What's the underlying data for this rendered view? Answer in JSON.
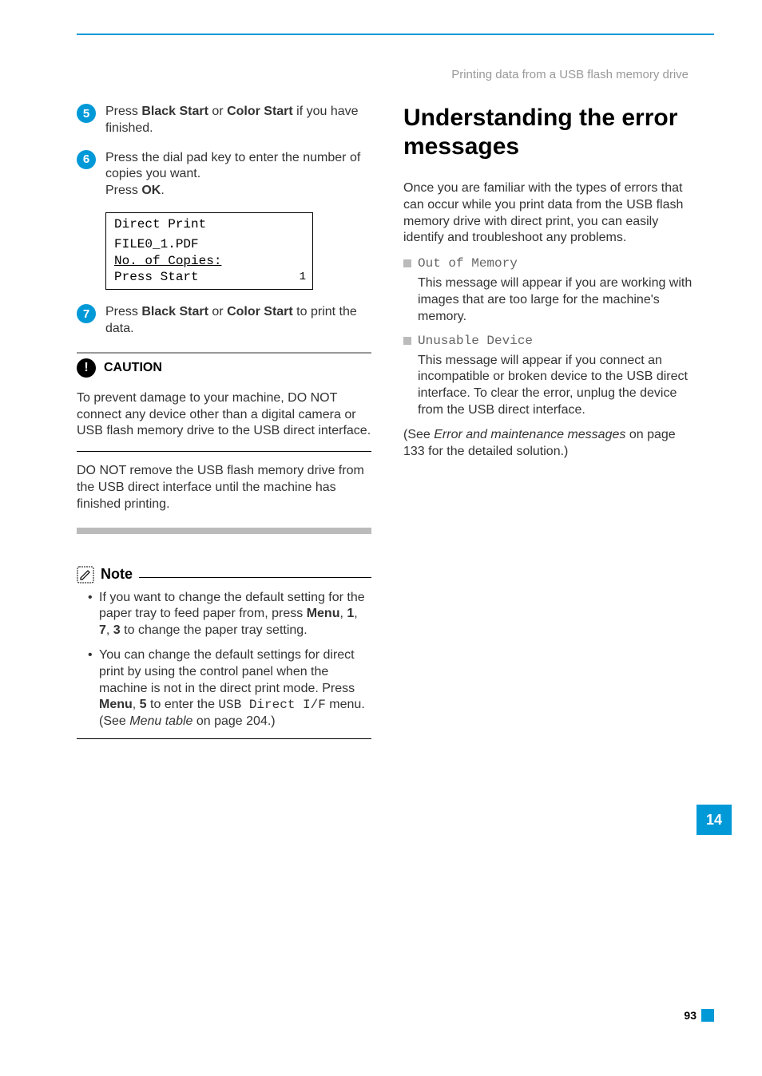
{
  "header": "Printing data from a USB flash memory drive",
  "steps": {
    "s5": {
      "num": "5",
      "text_pre": "Press ",
      "b1": "Black Start",
      "mid1": " or ",
      "b2": "Color Start",
      "text_post": " if you have finished."
    },
    "s6": {
      "num": "6",
      "line1": "Press the dial pad key to enter the number of copies you want.",
      "press": "Press ",
      "ok": "OK",
      "dot": "."
    },
    "lcd": {
      "l1": "Direct Print",
      "l2": " FILE0_1.PDF",
      "l3": "   No. of Copies:",
      "l4": "Press Start",
      "arrow": "1"
    },
    "s7": {
      "num": "7",
      "pre": "Press ",
      "b1": "Black Start",
      "mid": " or ",
      "b2": "Color Start",
      "post": " to print the data."
    }
  },
  "caution": {
    "label": "CAUTION",
    "p1": "To prevent damage to your machine, DO NOT connect any device other than a digital camera or USB flash memory drive to the USB direct interface.",
    "p2": "DO NOT remove the USB flash memory drive from the USB direct interface until the machine has finished printing."
  },
  "note": {
    "label": "Note",
    "n1_pre": "If you want to change the default setting for the paper tray to feed paper from, press ",
    "n1_b1": "Menu",
    "n1_c1": ", ",
    "n1_b2": "1",
    "n1_c2": ", ",
    "n1_b3": "7",
    "n1_c3": ", ",
    "n1_b4": "3",
    "n1_post": " to change the paper tray setting.",
    "n2_pre": "You can change the default settings for direct print by using the control panel when the machine is not in the direct print mode. Press ",
    "n2_b1": "Menu",
    "n2_c1": ", ",
    "n2_b2": "5",
    "n2_mid": " to enter the ",
    "n2_mono": "USB Direct I/F",
    "n2_post1": " menu. (See ",
    "n2_i": "Menu table",
    "n2_post2": " on page 204.)"
  },
  "right": {
    "title": "Understanding the error messages",
    "intro": "Once you are familiar with the types of errors that can occur while you print data from the USB flash memory drive with direct print, you can easily identify and troubleshoot any problems.",
    "b1_label": "Out of Memory",
    "b1_body": "This message will appear if you are working with images that are too large for the machine's memory.",
    "b2_label": "Unusable Device",
    "b2_body": "This message will appear if you connect an incompatible or broken device to the USB direct interface. To clear the error, unplug the device from the USB direct interface.",
    "see_pre": "(See ",
    "see_i": "Error and maintenance messages",
    "see_post": " on page 133 for the detailed solution.)"
  },
  "sidetab": "14",
  "pagenum": "93"
}
